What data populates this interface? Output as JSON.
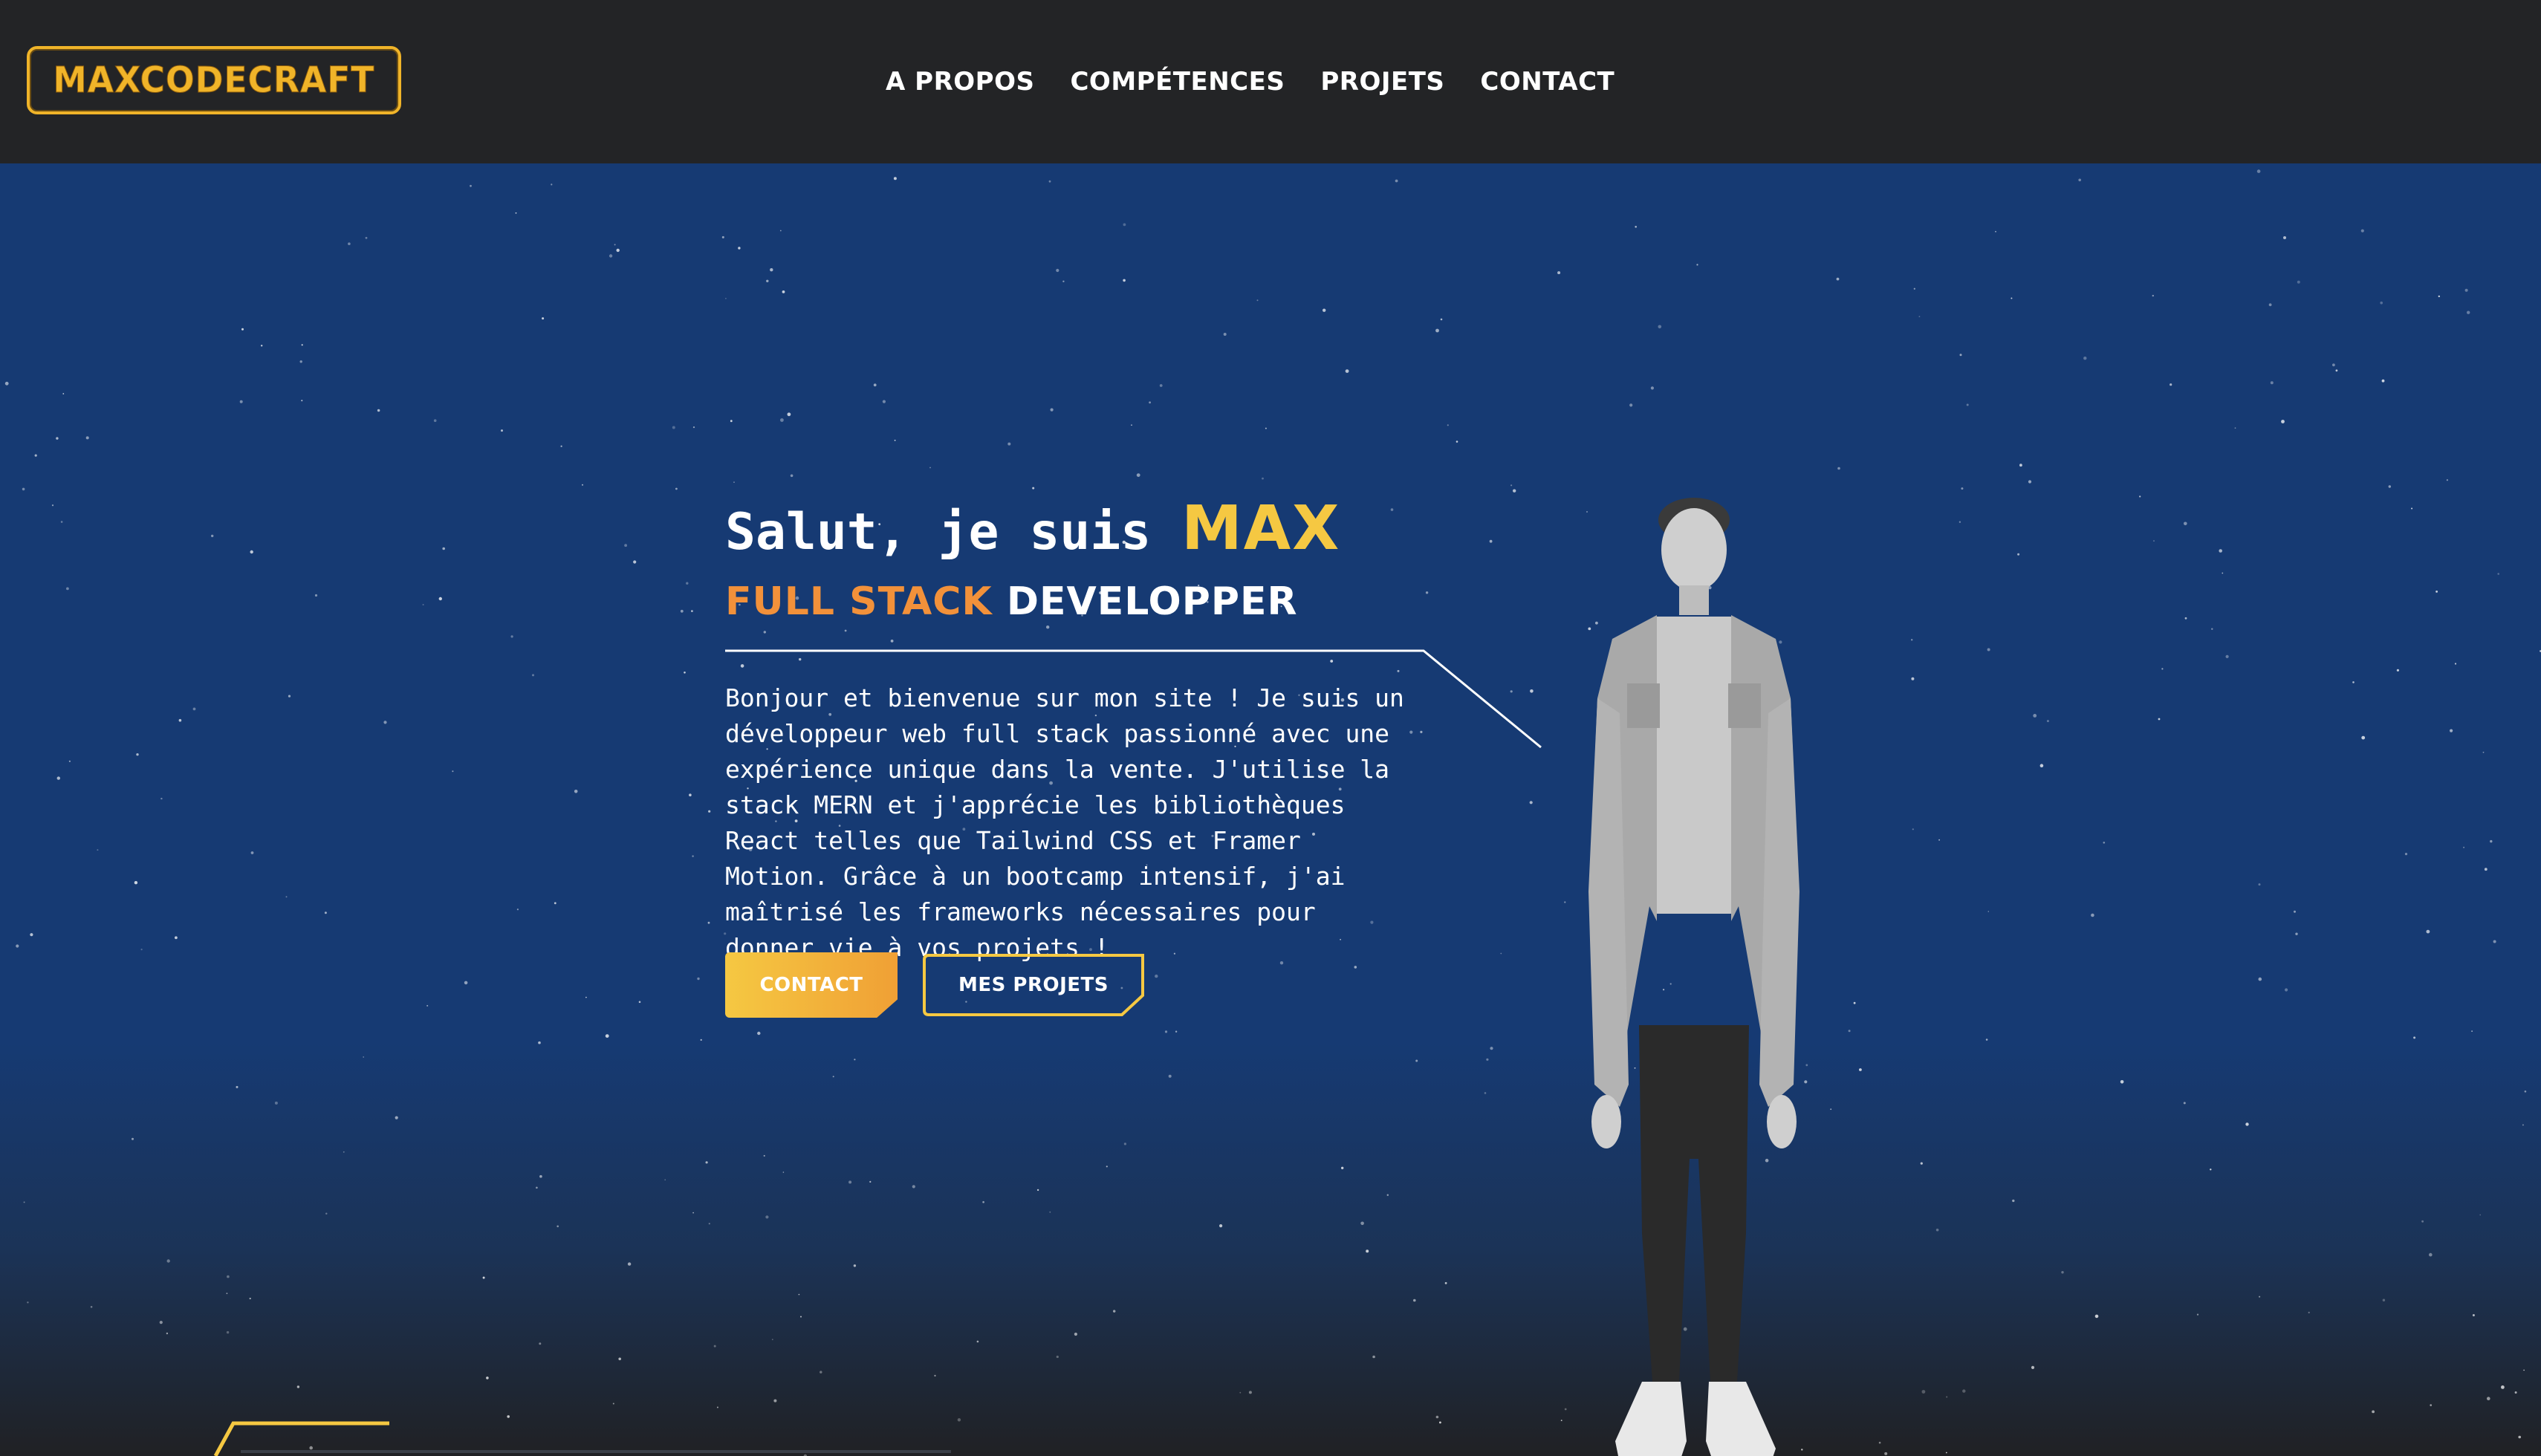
{
  "header": {
    "logo_text": "MAXCODECRAFT",
    "nav": [
      {
        "label": "A PROPOS"
      },
      {
        "label": "COMPÉTENCES"
      },
      {
        "label": "PROJETS"
      },
      {
        "label": "CONTACT"
      }
    ]
  },
  "hero": {
    "greeting_prefix": "Salut, je suis ",
    "name": "MAX",
    "role_highlight": "FULL STACK",
    "role_rest": " DEVELOPPER",
    "bio": "Bonjour et bienvenue sur mon site ! Je suis un développeur web full stack passionné avec une expérience unique dans la vente. J'utilise la stack MERN et j'apprécie les bibliothèques React telles que Tailwind CSS et Framer Motion. Grâce à un bootcamp intensif, j'ai maîtrisé les frameworks nécessaires pour donner vie à vos projets !",
    "contact_button": "CONTACT",
    "projects_button": "MES PROJETS"
  },
  "colors": {
    "header_bg": "#232426",
    "hero_bg": "#163a73",
    "accent_yellow": "#f5c842",
    "accent_orange": "#f2913a",
    "logo_gold": "#f0b429",
    "text": "#ffffff"
  }
}
